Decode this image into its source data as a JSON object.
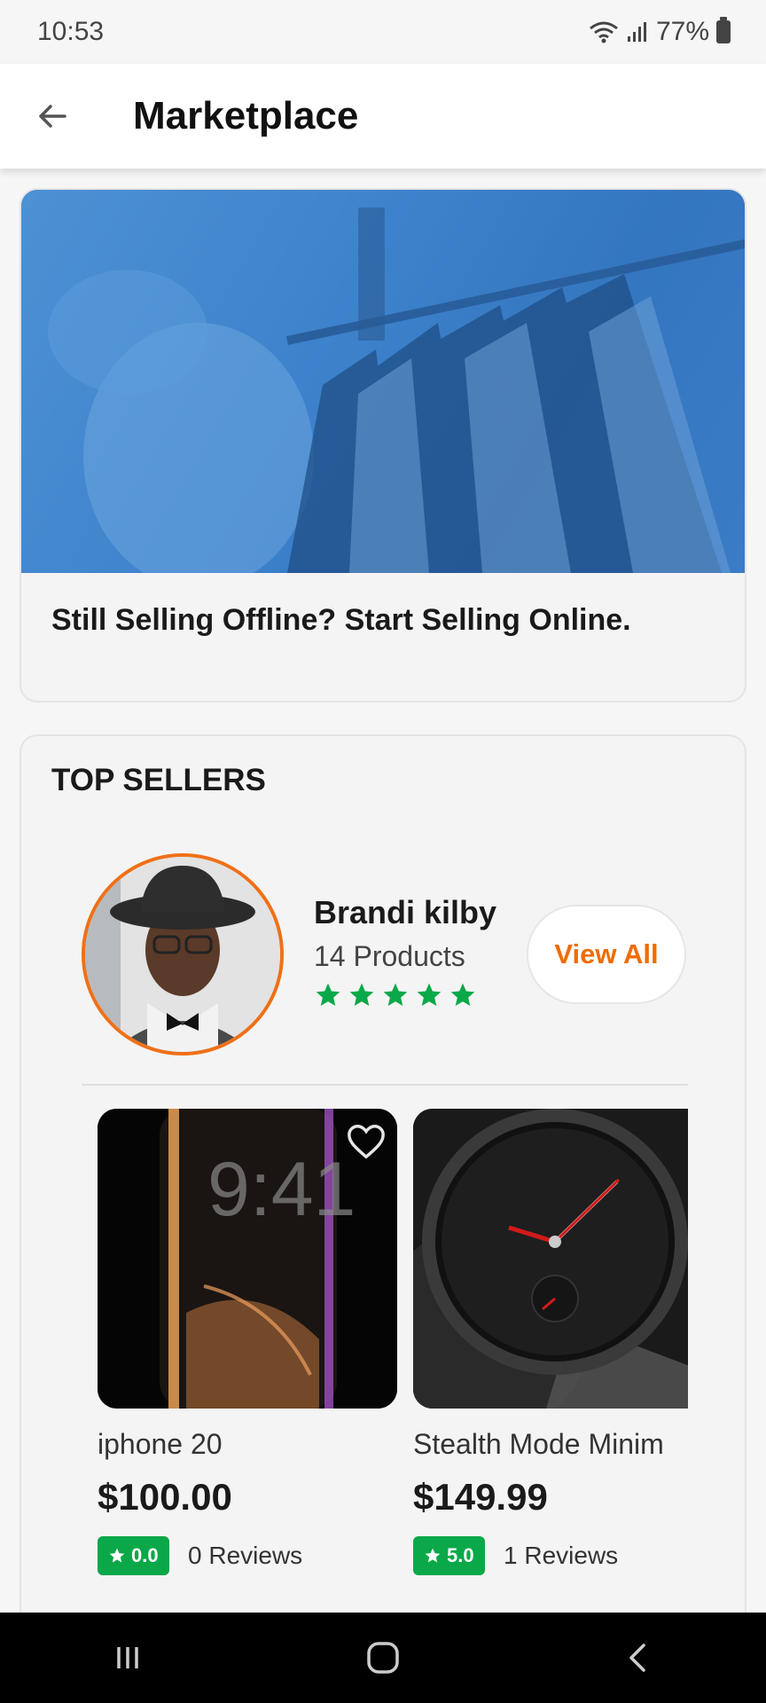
{
  "status_bar": {
    "time": "10:53",
    "battery": "77%"
  },
  "app_bar": {
    "title": "Marketplace"
  },
  "banner": {
    "text": "Still Selling Offline? Start Selling Online."
  },
  "top_sellers": {
    "title": "TOP SELLERS",
    "seller": {
      "name": "Brandi kilby",
      "products": "14 Products",
      "rating_stars": 5
    },
    "view_all_label": "View All",
    "products": [
      {
        "name": "iphone 20",
        "price": "$100.00",
        "rating": "0.0",
        "reviews": "0 Reviews"
      },
      {
        "name": "Stealth Mode Minim",
        "price": "$149.99",
        "rating": "5.0",
        "reviews": "1 Reviews"
      }
    ]
  },
  "colors": {
    "accent": "#ef6c00",
    "star_green": "#0aa848",
    "banner_blue": "#3f84cc"
  },
  "icons": [
    "back-arrow-icon",
    "wifi-icon",
    "signal-icon",
    "battery-icon",
    "star-icon",
    "heart-icon",
    "recents-icon",
    "home-icon",
    "back-icon"
  ]
}
